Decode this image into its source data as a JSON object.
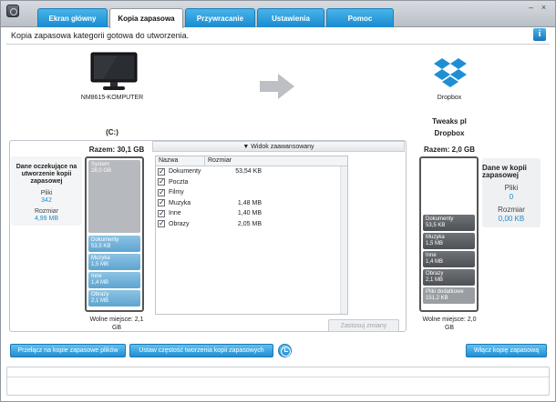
{
  "window": {
    "tabs": [
      {
        "label": "Ekran główny"
      },
      {
        "label": "Kopia zapasowa"
      },
      {
        "label": "Przywracanie"
      },
      {
        "label": "Ustawienia"
      },
      {
        "label": "Pomoc"
      }
    ],
    "active_tab": "Kopia zapasowa",
    "minimize_glyph": "–",
    "close_glyph": "×"
  },
  "status": {
    "text": "Kopia zapasowa kategorii gotowa do utworzenia.",
    "info_glyph": "i"
  },
  "source": {
    "computer_name": "NM8615-KOMPUTER",
    "drive": "(C:)",
    "total": "Razem: 30,1 GB",
    "free": "Wolne miejsce: 2,1 GB",
    "segments": [
      {
        "label": "System",
        "value": "28,0 GB"
      },
      {
        "label": "Dokumenty",
        "value": "53,5 KB"
      },
      {
        "label": "Muzyka",
        "value": "1,5 MB"
      },
      {
        "label": "Inne",
        "value": "1,4 MB"
      },
      {
        "label": "Obrazy",
        "value": "2,1 MB"
      }
    ]
  },
  "pending": {
    "title": "Dane oczekujące na utworzenie kopii zapasowej",
    "files_label": "Pliki",
    "files_value": "342",
    "size_label": "Rozmiar",
    "size_value": "4,99 MB"
  },
  "destination": {
    "service": "Dropbox",
    "name": "Tweaks pl Dropbox",
    "total": "Razem: 2,0 GB",
    "free": "Wolne miejsce: 2,0 GB",
    "segments": [
      {
        "label": "Dokumenty",
        "value": "53,5 KB"
      },
      {
        "label": "Muzyka",
        "value": "1,5 MB"
      },
      {
        "label": "Inne",
        "value": "1,4 MB"
      },
      {
        "label": "Obrazy",
        "value": "2,1 MB"
      },
      {
        "label": "Pliki dodatkowe",
        "value": "151,2 KB"
      }
    ]
  },
  "backed_up": {
    "title": "Dane w kopii zapasowej",
    "files_label": "Pliki",
    "files_value": "0",
    "size_label": "Rozmiar",
    "size_value": "0,00 KB"
  },
  "advanced": {
    "toggle_label": "▼ Widok zaawansowany",
    "columns": [
      "Nazwa",
      "Rozmiar"
    ],
    "rows": [
      {
        "name": "Dokumenty",
        "size": "53,54 KB"
      },
      {
        "name": "Poczta",
        "size": ""
      },
      {
        "name": "Filmy",
        "size": ""
      },
      {
        "name": "Muzyka",
        "size": "1,48 MB"
      },
      {
        "name": "Inne",
        "size": "1,40 MB"
      },
      {
        "name": "Obrazy",
        "size": "2,05 MB"
      }
    ],
    "apply_label": "Zastosuj zmiany"
  },
  "buttons": {
    "switch_label": "Przełącz na kopie zapasowe plików",
    "frequency_label": "Ustaw częstość tworzenia kopii zapasowych",
    "enable_label": "Włącz kopię zapasową"
  },
  "colors": {
    "accent": "#1f8fd4",
    "value_text": "#1a8bd0"
  }
}
